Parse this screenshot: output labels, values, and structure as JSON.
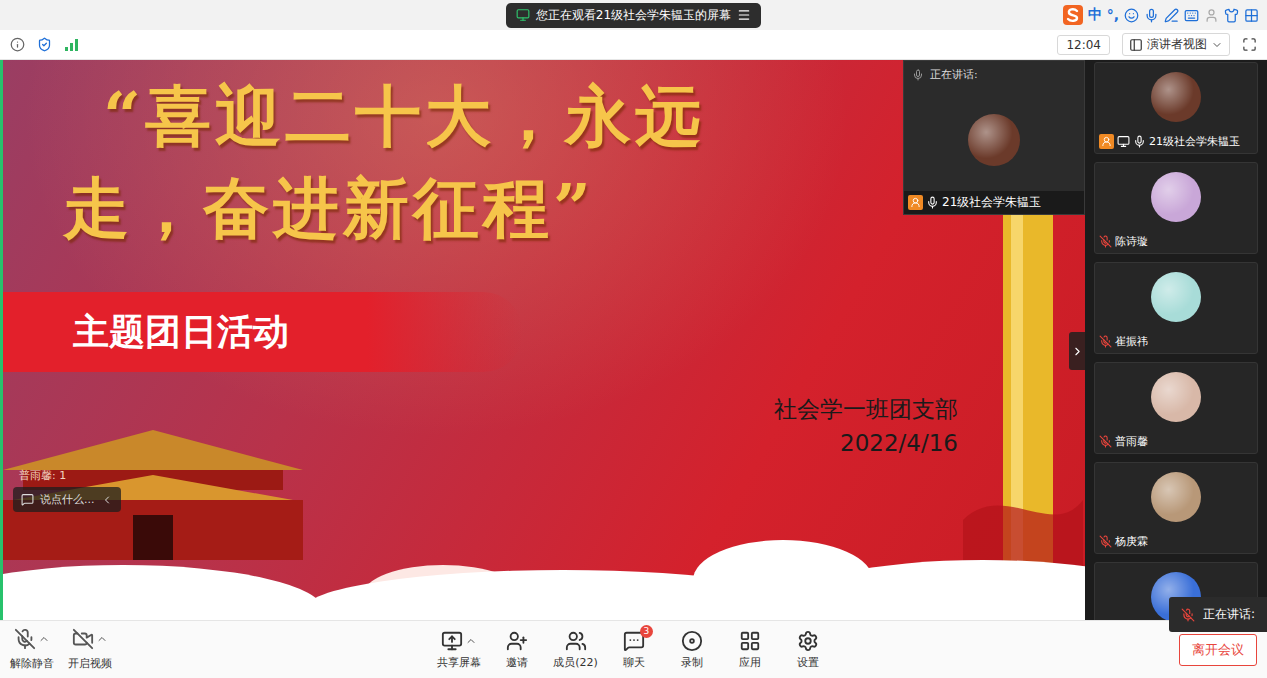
{
  "banner": {
    "text": "您正在观看21级社会学朱韫玉的屏幕"
  },
  "ime": {
    "language": "中",
    "punctuation": "°,"
  },
  "infobar": {
    "time": "12:04",
    "view": "演讲者视图"
  },
  "slide": {
    "title_lines": [
      "“喜迎二十大，永远",
      "走，奋进新征程”"
    ],
    "subtitle": "主题团日活动",
    "org": "社会学一班团支部",
    "date": "2022/4/16"
  },
  "chat_overlay": {
    "message": "普雨馨: 1",
    "placeholder": "说点什么..."
  },
  "speaker_window": {
    "label": "正在讲话:",
    "name": "21级社会学朱韫玉",
    "muted": false,
    "color": "#6b3a2a"
  },
  "participants": [
    {
      "name": "21级社会学朱韫玉",
      "muted": false,
      "sharing": true,
      "host": true,
      "color": "#6b3a2a"
    },
    {
      "name": "陈诗璇",
      "muted": true,
      "sharing": false,
      "host": false,
      "color": "#c9a7d8"
    },
    {
      "name": "崔振祎",
      "muted": true,
      "sharing": false,
      "host": false,
      "color": "#a8dcd8"
    },
    {
      "name": "普雨馨",
      "muted": true,
      "sharing": false,
      "host": false,
      "color": "#d8b8a8"
    },
    {
      "name": "杨庚霖",
      "muted": true,
      "sharing": false,
      "host": false,
      "color": "#b89878"
    },
    {
      "muted": true,
      "sharing": false,
      "host": false,
      "color": "#3a6fd8"
    }
  ],
  "speaking_toast": {
    "label": "正在讲话:",
    "muted": true
  },
  "toolbar": {
    "left": [
      {
        "kind": "mic",
        "label": "解除静音",
        "off": true
      },
      {
        "kind": "video",
        "label": "开启视频",
        "off": true
      }
    ],
    "center": [
      {
        "kind": "share",
        "label": "共享屏幕",
        "menu": true
      },
      {
        "kind": "invite",
        "label": "邀请",
        "menu": false
      },
      {
        "kind": "members",
        "label": "成员(22)",
        "menu": false
      },
      {
        "kind": "chat",
        "label": "聊天",
        "menu": false,
        "badge": "3"
      },
      {
        "kind": "record",
        "label": "录制",
        "menu": false
      },
      {
        "kind": "apps",
        "label": "应用",
        "menu": false
      },
      {
        "kind": "settings",
        "label": "设置",
        "menu": false
      }
    ],
    "leave": "离开会议"
  }
}
